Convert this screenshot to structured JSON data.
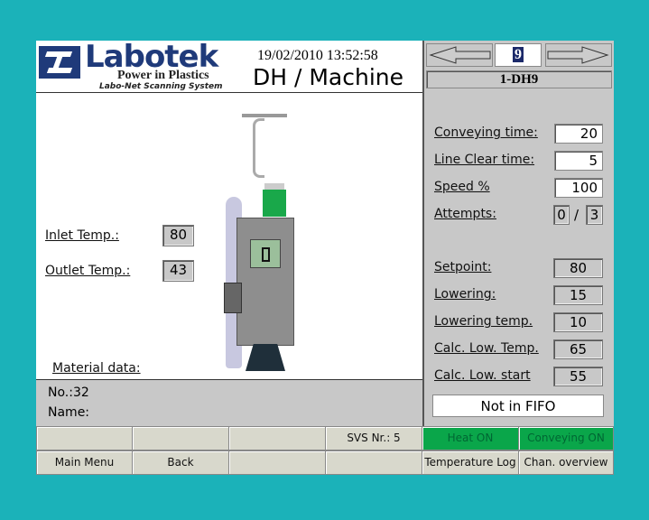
{
  "header": {
    "brand": "Labotek",
    "tagline": "Power in Plastics",
    "subtitle": "Labo-Net Scanning System",
    "datetime": "19/02/2010 13:52:58",
    "title": "DH / Machine"
  },
  "nav": {
    "channel": "9",
    "machine_name": "1-DH9"
  },
  "left": {
    "inlet_label": "Inlet Temp.:",
    "inlet_value": "80",
    "outlet_label": "Outlet Temp.:",
    "outlet_value": "43",
    "material_label": "Material data:",
    "no": "No.:32",
    "name": "Name:"
  },
  "params": {
    "conveying_label": "Conveying time:",
    "conveying_value": "20",
    "lineclear_label": "Line Clear time:",
    "lineclear_value": "5",
    "speed_label": "Speed %",
    "speed_value": "100",
    "attempts_label": "Attempts:",
    "attempts_done": "0",
    "attempts_sep": "/",
    "attempts_max": "3",
    "setpoint_label": "Setpoint:",
    "setpoint_value": "80",
    "lowering_label": "Lowering:",
    "lowering_value": "15",
    "lowtemp_label": "Lowering temp.",
    "lowtemp_value": "10",
    "calclowtemp_label": "Calc. Low. Temp.",
    "calclowtemp_value": "65",
    "calclowstart_label": "Calc. Low. start",
    "calclowstart_value": "55",
    "fifo_status": "Not in FIFO"
  },
  "bottom": {
    "svs": "SVS Nr.: 5",
    "heat": "Heat ON",
    "conveying": "Conveying ON",
    "main_menu": "Main Menu",
    "back": "Back",
    "temp_log": "Temperature Log",
    "chan_overview": "Chan. overview"
  },
  "colors": {
    "background": "#1bb2b9",
    "status_on": "#0aa64a",
    "brand": "#1f3a7a"
  }
}
